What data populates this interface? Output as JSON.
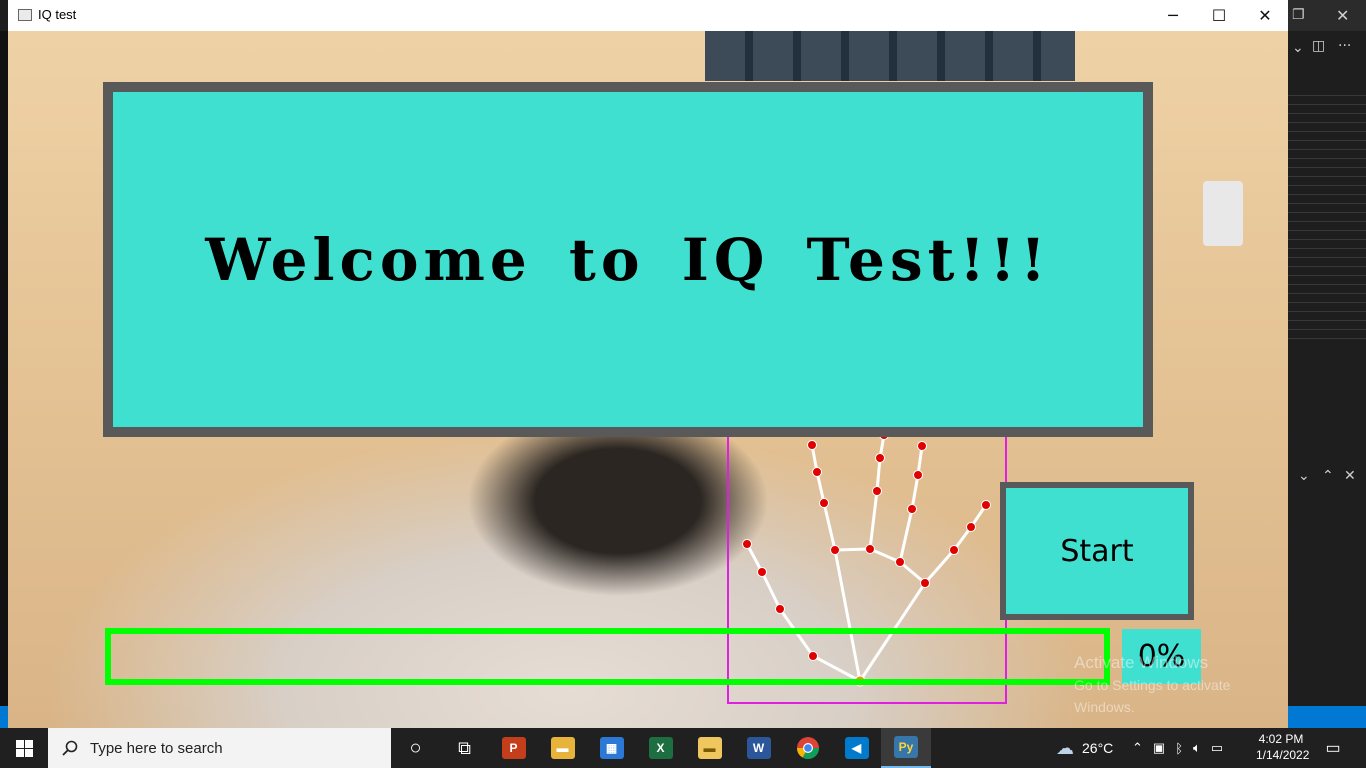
{
  "window": {
    "title": "IQ test"
  },
  "welcome": {
    "text": "Welcome to IQ Test!!!"
  },
  "start_button": {
    "label": "Start"
  },
  "progress": {
    "value": 0,
    "label": "0%"
  },
  "watermark": {
    "line1": "Activate Windows",
    "line2": "Go to Settings to activate Windows."
  },
  "taskbar": {
    "search_placeholder": "Type here to search",
    "weather": "26°C",
    "time": "4:02 PM",
    "date": "1/14/2022",
    "pinned": [
      {
        "name": "cortana",
        "glyph": "○",
        "color": "transparent"
      },
      {
        "name": "task-view",
        "glyph": "⧉",
        "color": "transparent"
      },
      {
        "name": "powerpoint",
        "glyph": "P",
        "color": "#c43e1c"
      },
      {
        "name": "file-explorer",
        "glyph": "▬",
        "color": "#e8b33a"
      },
      {
        "name": "store",
        "glyph": "▦",
        "color": "#2b78d6"
      },
      {
        "name": "excel",
        "glyph": "X",
        "color": "#1d6f42"
      },
      {
        "name": "files",
        "glyph": "▬",
        "color": "#f0c75e"
      },
      {
        "name": "word",
        "glyph": "W",
        "color": "#2b579a"
      },
      {
        "name": "chrome",
        "glyph": "●",
        "color": "#db4437"
      },
      {
        "name": "vscode",
        "glyph": "◀",
        "color": "#007acc"
      },
      {
        "name": "python",
        "glyph": "Py",
        "color": "#3776ab"
      }
    ]
  },
  "colors": {
    "panel": "#40e0d0",
    "border": "#595959",
    "progress": "#00ff00",
    "bbox": "#e020e0"
  }
}
